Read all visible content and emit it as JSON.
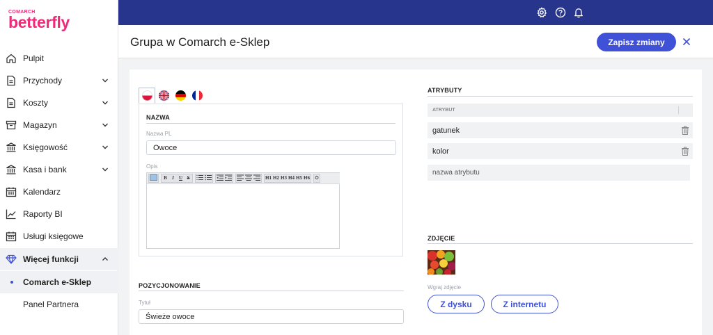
{
  "brand": {
    "small": "COMARCH",
    "big": "betterfly"
  },
  "nav": {
    "items": [
      {
        "label": "Pulpit",
        "icon": "home-icon"
      },
      {
        "label": "Przychody",
        "icon": "document-icon"
      },
      {
        "label": "Koszty",
        "icon": "document-icon"
      },
      {
        "label": "Magazyn",
        "icon": "box-icon"
      },
      {
        "label": "Księgowość",
        "icon": "bank-icon"
      },
      {
        "label": "Kasa i bank",
        "icon": "bank-icon"
      },
      {
        "label": "Kalendarz",
        "icon": "calendar-icon"
      },
      {
        "label": "Raporty BI",
        "icon": "chart-icon"
      },
      {
        "label": "Usługi księgowe",
        "icon": "calendar-icon"
      },
      {
        "label": "Więcej funkcji",
        "icon": "diamond-icon"
      },
      {
        "label": "Comarch e-Sklep"
      },
      {
        "label": "Panel Partnera"
      }
    ]
  },
  "header": {
    "title": "Grupa w Comarch e-Sklep",
    "save_label": "Zapisz zmiany"
  },
  "nazwa": {
    "section_title": "NAZWA",
    "name_label": "Nazwa PL",
    "name_value": "Owoce",
    "desc_label": "Opis"
  },
  "editor": {
    "toolbar": {
      "format": [
        "B",
        "I",
        "U",
        "S"
      ],
      "headings": [
        "H1",
        "H2",
        "H3",
        "H4",
        "H5",
        "H6"
      ]
    }
  },
  "pozycjonowanie": {
    "section_title": "POZYCJONOWANIE",
    "title_label": "Tytuł",
    "title_value": "Świeże owoce"
  },
  "atrybuty": {
    "section_title": "ATRYBUTY",
    "column_header": "ATRYBUT",
    "rows": [
      "gatunek",
      "kolor"
    ],
    "new_placeholder": "nazwa atrybutu"
  },
  "zdjecie": {
    "section_title": "ZDJĘCIE",
    "upload_label": "Wgraj zdjęcie",
    "disk_button": "Z dysku",
    "internet_button": "Z internetu"
  },
  "colors": {
    "accent": "#3f51d6",
    "topbar": "#27358c",
    "brand": "#ee2a7b"
  }
}
